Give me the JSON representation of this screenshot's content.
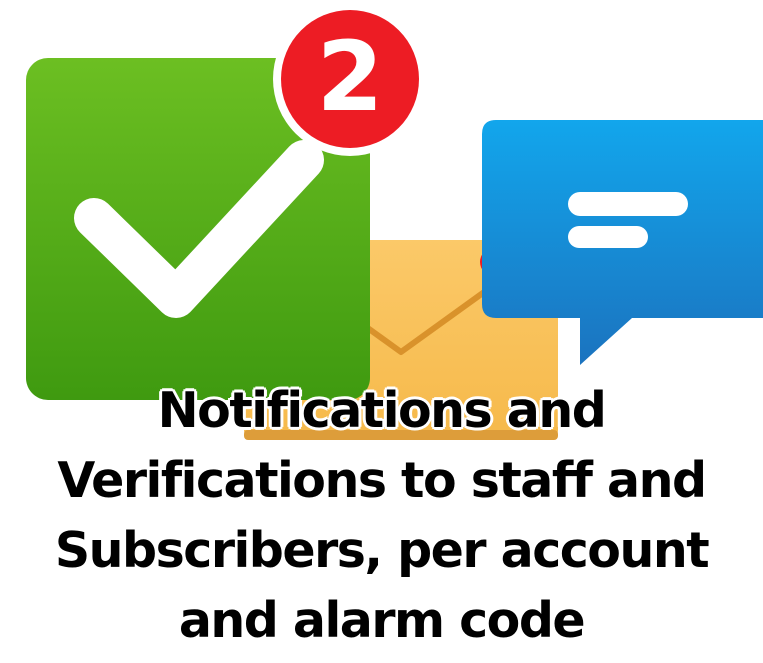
{
  "notification_badge": {
    "count": "2",
    "color": "#ed1c24"
  },
  "icons": {
    "checkmark": "check-icon",
    "envelope": "envelope-icon",
    "chat": "chat-bubble-icon"
  },
  "colors": {
    "check_green": "#4fa818",
    "envelope_orange": "#f9c05c",
    "chat_blue": "#1b8fd9"
  },
  "caption": {
    "lines": [
      "Notifications and",
      "Verifications to staff and",
      "Subscribers, per account",
      "and alarm code"
    ]
  }
}
